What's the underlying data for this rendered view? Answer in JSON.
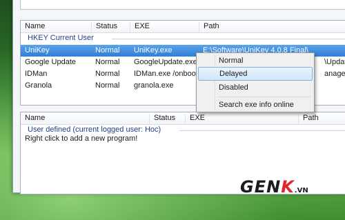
{
  "top_table": {
    "columns": [
      "Name",
      "Status",
      "EXE",
      "Path"
    ],
    "group_title": "HKEY Current User",
    "rows": [
      {
        "name": "UniKey",
        "status": "Normal",
        "exe": "UniKey.exe",
        "path": "E:\\Software\\UniKey 4.0.8 Final\\",
        "selected": true
      },
      {
        "name": "Google Update",
        "status": "Normal",
        "exe": "GoogleUpdate.exe",
        "path": "\\Update\\"
      },
      {
        "name": "IDMan",
        "status": "Normal",
        "exe": "IDMan.exe /onboot",
        "path": "anager\\"
      },
      {
        "name": "Granola",
        "status": "Normal",
        "exe": "granola.exe",
        "path": ""
      }
    ]
  },
  "bottom_table": {
    "columns": [
      "Name",
      "Status",
      "EXE",
      "Path"
    ],
    "group_title": "User defined (current logged user: Hoc)",
    "empty_message": "Right click to add a new program!"
  },
  "context_menu": {
    "items": [
      "Normal",
      "Delayed",
      "Disabled",
      "Search exe info online"
    ],
    "highlighted_index": 1
  },
  "watermark": {
    "main": "GEN",
    "accent": "K",
    "suffix": ".VN"
  },
  "colors": {
    "selection": "#3a8de0",
    "group_title": "#1f3d8a",
    "accent_red": "#e3262e"
  }
}
